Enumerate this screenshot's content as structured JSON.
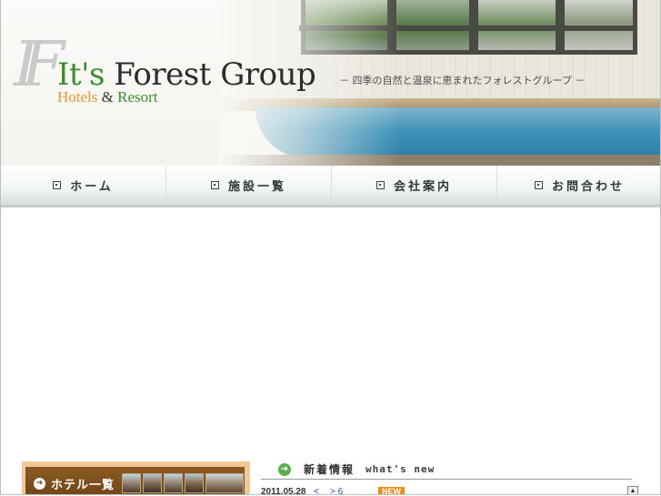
{
  "brand": {
    "monogram": "IF",
    "its": "It's",
    "name": "Forest Group",
    "sub_hotels": "Hotels",
    "sub_amp": "&",
    "sub_resort": "Resort",
    "tagline": "－ 四季の自然と温泉に恵まれたフォレストグループ －"
  },
  "nav": {
    "items": [
      {
        "label": "ホーム"
      },
      {
        "label": "施設一覧"
      },
      {
        "label": "会社案内"
      },
      {
        "label": "お問合わせ"
      }
    ]
  },
  "sidebar": {
    "hotel_list_label": "ホテル一覧",
    "icon": "arrow-right-icon"
  },
  "news": {
    "title_jp": "新着情報",
    "title_en": "what's new",
    "items": [
      {
        "date": "2011.05.28",
        "prev": "<",
        "next": "> 6",
        "badge": "NEW"
      }
    ]
  },
  "colors": {
    "accent_green": "#3b8e2f",
    "accent_orange": "#e7972a",
    "badge_new": "#f08a18",
    "hotel_box": "#6e4415"
  }
}
